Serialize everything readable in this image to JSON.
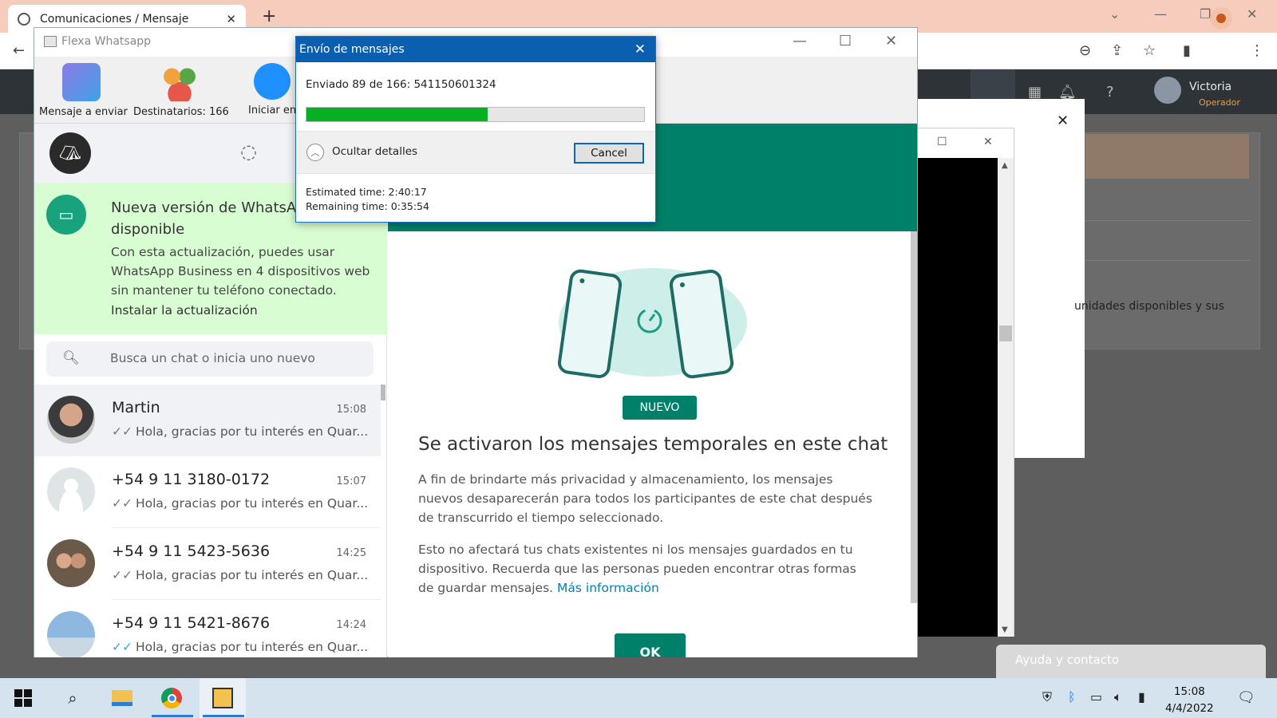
{
  "browser": {
    "tab_title": "Comunicaciones / Mensaje",
    "new_tab": "+",
    "minimize": "—",
    "restore": "❐",
    "close": "✕",
    "back": "←"
  },
  "crm": {
    "user_name": "Victoria",
    "user_role": "Operador",
    "modal_text": "unidades disponibles y sus",
    "help_label": "Ayuda y contacto"
  },
  "flexa": {
    "title": "Flexa Whatsapp",
    "ribbon": [
      {
        "label": "Mensaje a enviar"
      },
      {
        "label": "Destinatarios: 166"
      },
      {
        "label": "Iniciar en"
      }
    ]
  },
  "whatsapp": {
    "banner": {
      "title": "Nueva versión de WhatsApp disponible",
      "description": "Con esta actualización, puedes usar WhatsApp Business en 4 dispositivos web sin mantener tu teléfono conectado.",
      "link": "Instalar la actualización"
    },
    "search_placeholder": "Busca un chat o inicia uno nuevo",
    "chats": [
      {
        "name": "Martin",
        "time": "15:08",
        "preview": "Hola, gracias por tu interés en Quar..."
      },
      {
        "name": "+54 9 11 3180-0172",
        "time": "15:07",
        "preview": "Hola, gracias por tu interés en Quar..."
      },
      {
        "name": "+54 9 11 5423-5636",
        "time": "14:25",
        "preview": "Hola, gracias por tu interés en Quar..."
      },
      {
        "name": "+54 9 11 5421-8676",
        "time": "14:24",
        "preview": "Hola, gracias por tu interés en Quar..."
      }
    ],
    "main": {
      "badge": "NUEVO",
      "title": "Se activaron los mensajes temporales en este chat",
      "p1": "A fin de brindarte más privacidad y almacenamiento, los mensajes nuevos desaparecerán para todos los participantes de este chat después de transcurrido el tiempo seleccionado.",
      "p2": "Esto no afectará tus chats existentes ni los mensajes guardados en tu dispositivo. Recuerda que las personas pueden encontrar otras formas de guardar mensajes.",
      "link": "Más información",
      "ok": "OK"
    }
  },
  "dialog": {
    "title": "Envío de mensajes",
    "status": "Enviado 89 de 166: 541150601324",
    "progress": 0.536,
    "toggle_label": "Ocultar detalles",
    "cancel_label": "Cancel",
    "estimated": "Estimated time: 2:40:17",
    "remaining": "Remaining time: 0:35:54"
  },
  "taskbar": {
    "time": "15:08",
    "date": "4/4/2022"
  }
}
